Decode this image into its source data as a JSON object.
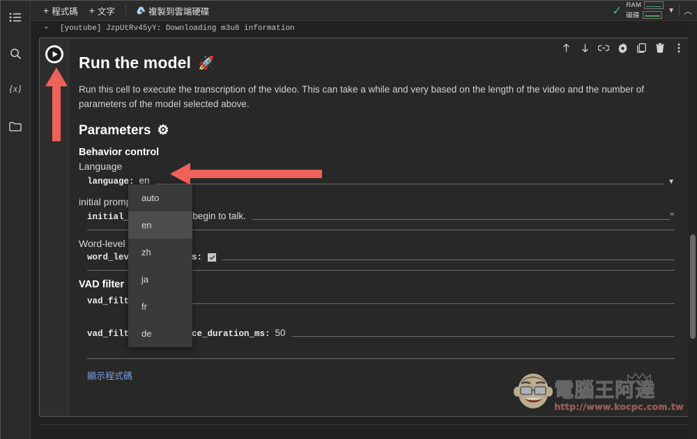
{
  "sidebar": {
    "items": [
      {
        "name": "table-of-contents",
        "icon": "list-icon"
      },
      {
        "name": "search",
        "icon": "search-icon"
      },
      {
        "name": "variables",
        "icon": "variables-icon",
        "glyph": "{x}"
      },
      {
        "name": "files",
        "icon": "folder-icon"
      }
    ]
  },
  "toolbar": {
    "add_code_label": "程式碼",
    "add_text_label": "文字",
    "copy_to_drive_label": "複製到雲端硬碟",
    "plus": "+",
    "ram_label": "RAM",
    "disk_label": "磁碟",
    "check_glyph": "✓",
    "caret_down": "▼",
    "chevron_up": "︿"
  },
  "previous_output": {
    "text": "[youtube] JzpUtRv45yY: Downloading m3u8 information",
    "chevron": "⌄"
  },
  "cell": {
    "run_button": "run-cell-button",
    "toolbar_icons": [
      "move-up-icon",
      "move-down-icon",
      "link-icon",
      "gear-icon",
      "duplicate-icon",
      "delete-icon",
      "more-vert-icon"
    ],
    "title": "Run the model",
    "title_emoji": "🚀",
    "description": "Run this cell to execute the transcription of the video. This can take a while and very based on the length of the video and the number of parameters of the model selected above.",
    "parameters_heading": "Parameters",
    "parameters_emoji": "⚙",
    "show_code_label": "顯示程式碼"
  },
  "form": {
    "group_behavior_control": "Behavior control",
    "fields": [
      {
        "label": "Language",
        "param": "language:",
        "value": "en",
        "kind": "select",
        "caret": "▼"
      },
      {
        "label": "initial prompt",
        "param": "initial_prompt:",
        "value": "Let's begin to talk.",
        "kind": "text",
        "quote": "\""
      },
      {
        "label": "Word-level timestamps",
        "param": "word_level_timestamps:",
        "value": "true",
        "kind": "checkbox",
        "checkmark": "✓"
      }
    ],
    "group_vad": "VAD filter",
    "vad_fields": [
      {
        "param": "vad_filter:",
        "value": "true",
        "kind": "checkbox"
      },
      {
        "param": "vad_filter_min_silence_duration_ms:",
        "value": "50",
        "kind": "number"
      }
    ]
  },
  "dropdown": {
    "open_for": "language",
    "selected": "en",
    "options": [
      "auto",
      "en",
      "zh",
      "ja",
      "fr",
      "de"
    ]
  },
  "annotations": [
    {
      "name": "arrow-up-to-run-button",
      "color": "#f0615a",
      "direction": "up"
    },
    {
      "name": "arrow-left-to-language-field",
      "color": "#f0615a",
      "direction": "left"
    }
  ],
  "watermark": {
    "brand": "電腦王阿達",
    "url": "http://www.kocpc.com.tw"
  },
  "colors": {
    "accent_blue": "#7a9fe8",
    "annotation_red": "#f0615a",
    "success_green": "#3ac46a",
    "bg": "#212121",
    "cell_bg": "#282828"
  }
}
